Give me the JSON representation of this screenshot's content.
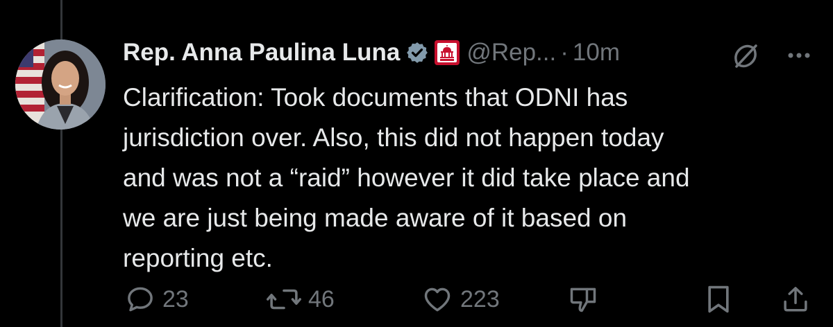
{
  "post": {
    "display_name": "Rep. Anna Paulina Luna",
    "handle": "@Rep...",
    "separator": "·",
    "time": "10m",
    "affiliation_badge": "House GOP",
    "text": "Clarification: Took documents that ODNI has\njurisdiction over. Also, this did not happen today\nand was not a “raid” however it did take place and\nwe are just being made aware of it based on\nreporting etc."
  },
  "actions": {
    "replies": "23",
    "reposts": "46",
    "likes": "223"
  },
  "icons": {
    "verified": "verified-badge-icon",
    "affiliation": "house-gop-capitol-icon",
    "grok": "grok-icon",
    "more": "more-dots-icon",
    "reply": "reply-bubble-icon",
    "repost": "repost-arrows-icon",
    "like": "heart-icon",
    "dislike": "thumbs-down-icon",
    "bookmark": "bookmark-icon",
    "share": "share-upload-icon"
  },
  "colors": {
    "background": "#000000",
    "text_primary": "#e7e9ea",
    "text_secondary": "#71767b",
    "verified_badge": "#829aab",
    "affiliation_red": "#c8102e"
  }
}
